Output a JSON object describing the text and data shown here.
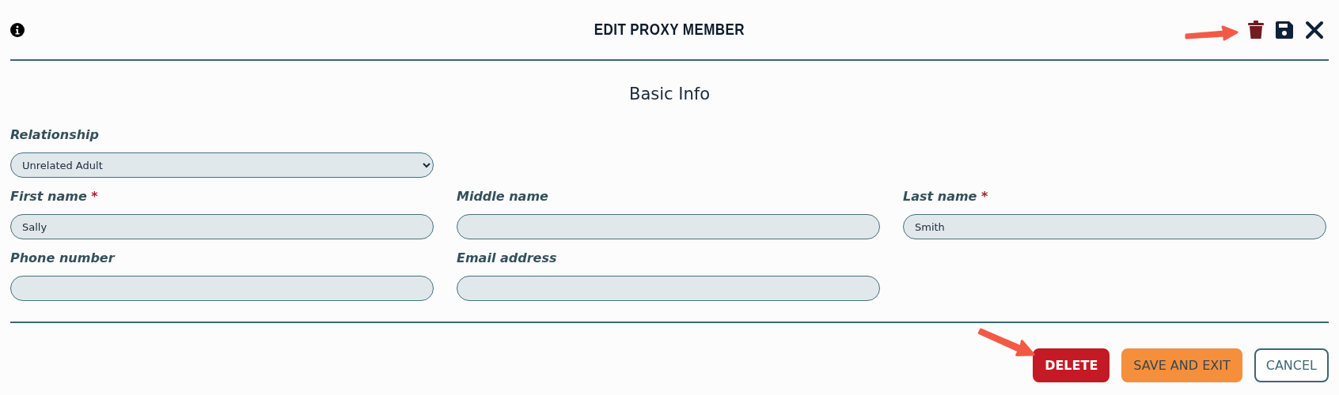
{
  "header": {
    "title": "EDIT PROXY MEMBER"
  },
  "section": {
    "title": "Basic Info"
  },
  "fields": [
    {
      "kind": "select",
      "label": "Relationship",
      "required": false,
      "value": "Unrelated Adult"
    },
    {
      "kind": "break"
    },
    {
      "kind": "input",
      "label": "First name",
      "required": true,
      "value": "Sally"
    },
    {
      "kind": "input",
      "label": "Middle name",
      "required": false
    },
    {
      "kind": "input",
      "label": "Last name",
      "required": true,
      "value": "Smith"
    },
    {
      "kind": "input",
      "label": "Phone number",
      "required": false
    },
    {
      "kind": "input",
      "label": "Email address",
      "required": false
    }
  ],
  "required_mark": "*",
  "buttons": [
    {
      "kind": "danger",
      "label": "DELETE"
    },
    {
      "kind": "primary",
      "label": "SAVE AND EXIT"
    },
    {
      "kind": "outline",
      "label": "CANCEL"
    }
  ]
}
